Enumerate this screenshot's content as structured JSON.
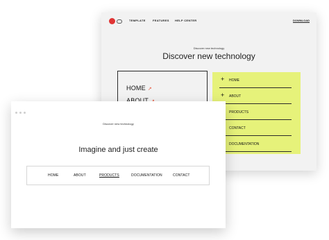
{
  "back_window": {
    "nav": {
      "items": [
        "TEMPLATE",
        "FEATURES",
        "HELP CENTER"
      ],
      "download": "DOWNLOAD"
    },
    "eyebrow": "Discover new technology",
    "title": "Discover new technology",
    "menu_box": [
      {
        "label": "HOME",
        "arrow": "↗"
      },
      {
        "label": "ABOUT",
        "arrow": "↗"
      }
    ],
    "panel": {
      "items": [
        {
          "label": "HOME",
          "icon": "+"
        },
        {
          "label": "ABOUT",
          "icon": "+"
        },
        {
          "label": "PRODUCTS",
          "icon": ""
        },
        {
          "label": "CONTACT",
          "icon": ""
        },
        {
          "label": "DOCUMENTATION",
          "icon": ""
        }
      ]
    },
    "colors": {
      "accent_red": "#e03434",
      "panel_lime": "#e6f27a",
      "arrow_orange": "#e8533a"
    }
  },
  "front_window": {
    "eyebrow": "Discover new technology",
    "title": "Imagine and just create",
    "nav": {
      "items": [
        "HOME",
        "ABOUT",
        "PRODUCTS",
        "DOCUMENTATION",
        "CONTACT"
      ],
      "active": "PRODUCTS"
    }
  }
}
